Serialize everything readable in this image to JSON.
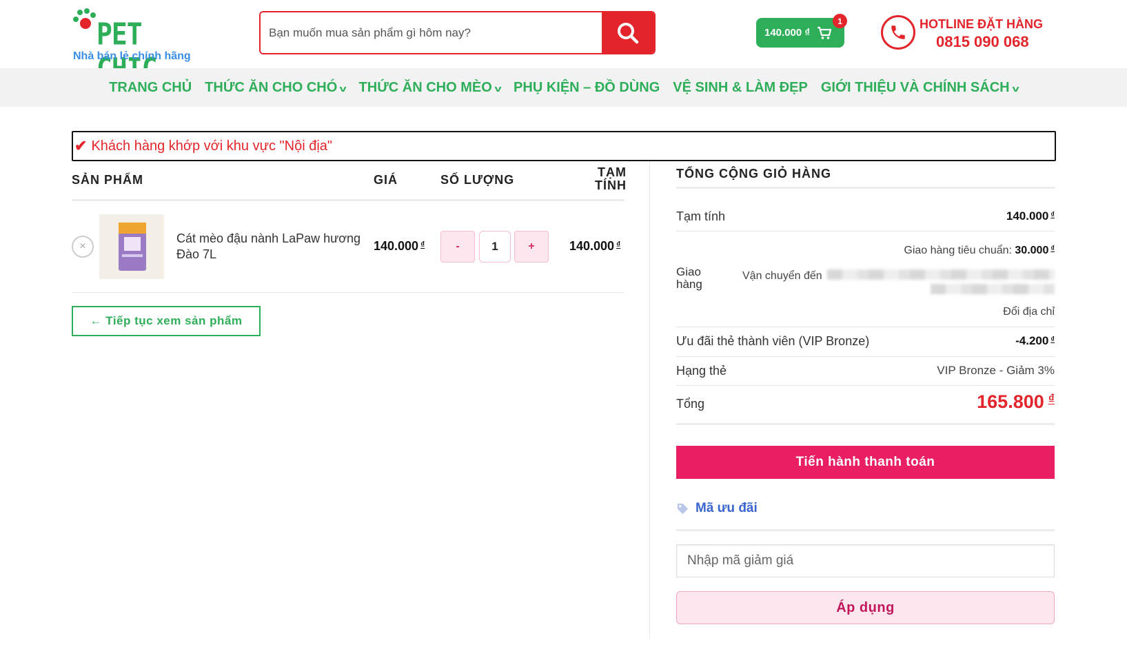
{
  "header": {
    "logo_text": "PET CHIC",
    "logo_tagline": "Nhà bán lẻ chính hãng",
    "search_placeholder": "Bạn muốn mua sản phẩm gì hôm nay?",
    "cart_total": "140.000 ₫",
    "cart_count": "1",
    "hotline_title": "HOTLINE ĐẶT HÀNG",
    "hotline_phone": "0815 090 068"
  },
  "nav": {
    "items": [
      {
        "label": "TRANG CHỦ",
        "has_dropdown": false
      },
      {
        "label": "THỨC ĂN CHO CHÓ",
        "has_dropdown": true
      },
      {
        "label": "THỨC ĂN CHO MÈO",
        "has_dropdown": true
      },
      {
        "label": "PHỤ KIỆN – ĐỒ DÙNG",
        "has_dropdown": false
      },
      {
        "label": "VỆ SINH & LÀM ĐẸP",
        "has_dropdown": false
      },
      {
        "label": "GIỚI THIỆU VÀ CHÍNH SÁCH",
        "has_dropdown": true
      }
    ]
  },
  "notice": {
    "text": "Khách hàng khớp với khu vực \"Nội địa\""
  },
  "cart_table": {
    "headers": {
      "product": "SẢN PHẨM",
      "price": "GIÁ",
      "quantity": "SỐ LƯỢNG",
      "subtotal_line1": "TẠM",
      "subtotal_line2": "TÍNH"
    },
    "items": [
      {
        "name": "Cát mèo đậu nành LaPaw hương Đào 7L",
        "price": "140.000",
        "quantity": "1",
        "subtotal": "140.000"
      }
    ],
    "currency_symbol": "₫",
    "qty_minus": "-",
    "qty_plus": "+",
    "remove_symbol": "×"
  },
  "continue_button": "← Tiếp tục xem sản phẩm",
  "totals": {
    "title": "TỔNG CỘNG GIỎ HÀNG",
    "subtotal_label": "Tạm tính",
    "subtotal_value": "140.000",
    "shipping_label_line1": "Giao",
    "shipping_label_line2": "hàng",
    "shipping_method": "Giao hàng tiêu chuẩn:",
    "shipping_cost": "30.000",
    "ship_to_label": "Vận chuyển đến",
    "change_address": "Đổi địa chỉ",
    "member_discount_label": "Ưu đãi thẻ thành viên (VIP Bronze)",
    "member_discount_value": "-4.200",
    "tier_label": "Hạng thẻ",
    "tier_value": "VIP Bronze - Giảm 3%",
    "total_label": "Tổng",
    "total_value": "165.800",
    "currency_symbol": "₫",
    "checkout_button": "Tiến hành thanh toán"
  },
  "coupon": {
    "title": "Mã ưu đãi",
    "placeholder": "Nhập mã giảm giá",
    "apply_button": "Áp dụng"
  },
  "colors": {
    "brand_green": "#2fae5a",
    "brand_red": "#e3252b",
    "checkout_pink": "#e91e63",
    "link_blue": "#3a66cf"
  }
}
